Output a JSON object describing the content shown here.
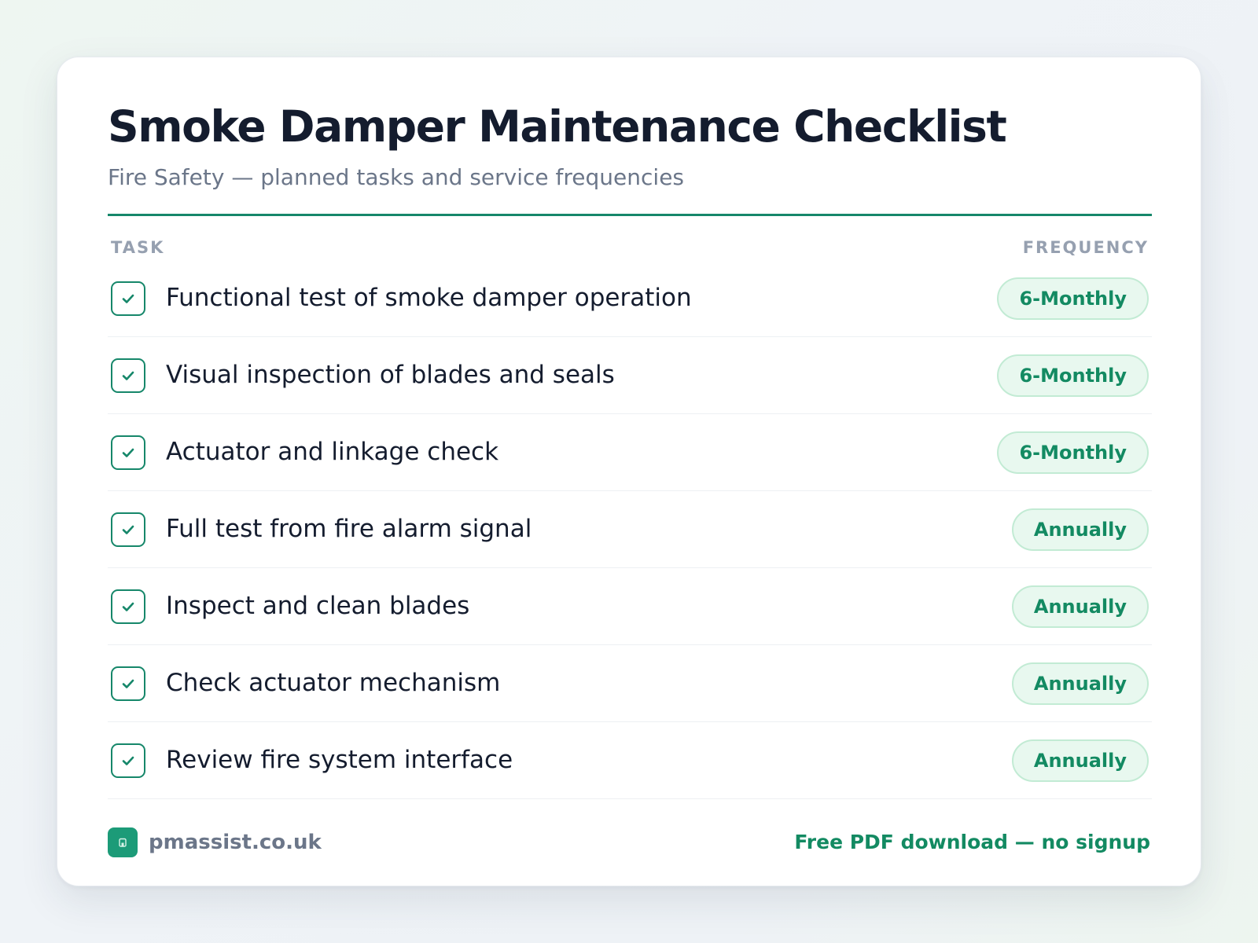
{
  "header": {
    "title": "Smoke Damper Maintenance Checklist",
    "subtitle": "Fire Safety — planned tasks and service frequencies"
  },
  "table": {
    "columns": {
      "task": "TASK",
      "frequency": "FREQUENCY"
    },
    "rows": [
      {
        "task": "Functional test of smoke damper operation",
        "frequency": "6-Monthly",
        "checked": true
      },
      {
        "task": "Visual inspection of blades and seals",
        "frequency": "6-Monthly",
        "checked": true
      },
      {
        "task": "Actuator and linkage check",
        "frequency": "6-Monthly",
        "checked": true
      },
      {
        "task": "Full test from fire alarm signal",
        "frequency": "Annually",
        "checked": true
      },
      {
        "task": "Inspect and clean blades",
        "frequency": "Annually",
        "checked": true
      },
      {
        "task": "Check actuator mechanism",
        "frequency": "Annually",
        "checked": true
      },
      {
        "task": "Review fire system interface",
        "frequency": "Annually",
        "checked": true
      }
    ]
  },
  "footer": {
    "site": "pmassist.co.uk",
    "cta": "Free PDF download — no signup",
    "logo_icon": "building-icon"
  },
  "colors": {
    "accent": "#16876a",
    "badge_bg": "#e8f8ef",
    "badge_border": "#c2ebd4",
    "badge_text": "#138a62",
    "title": "#141c2e",
    "muted": "#6b7689"
  }
}
